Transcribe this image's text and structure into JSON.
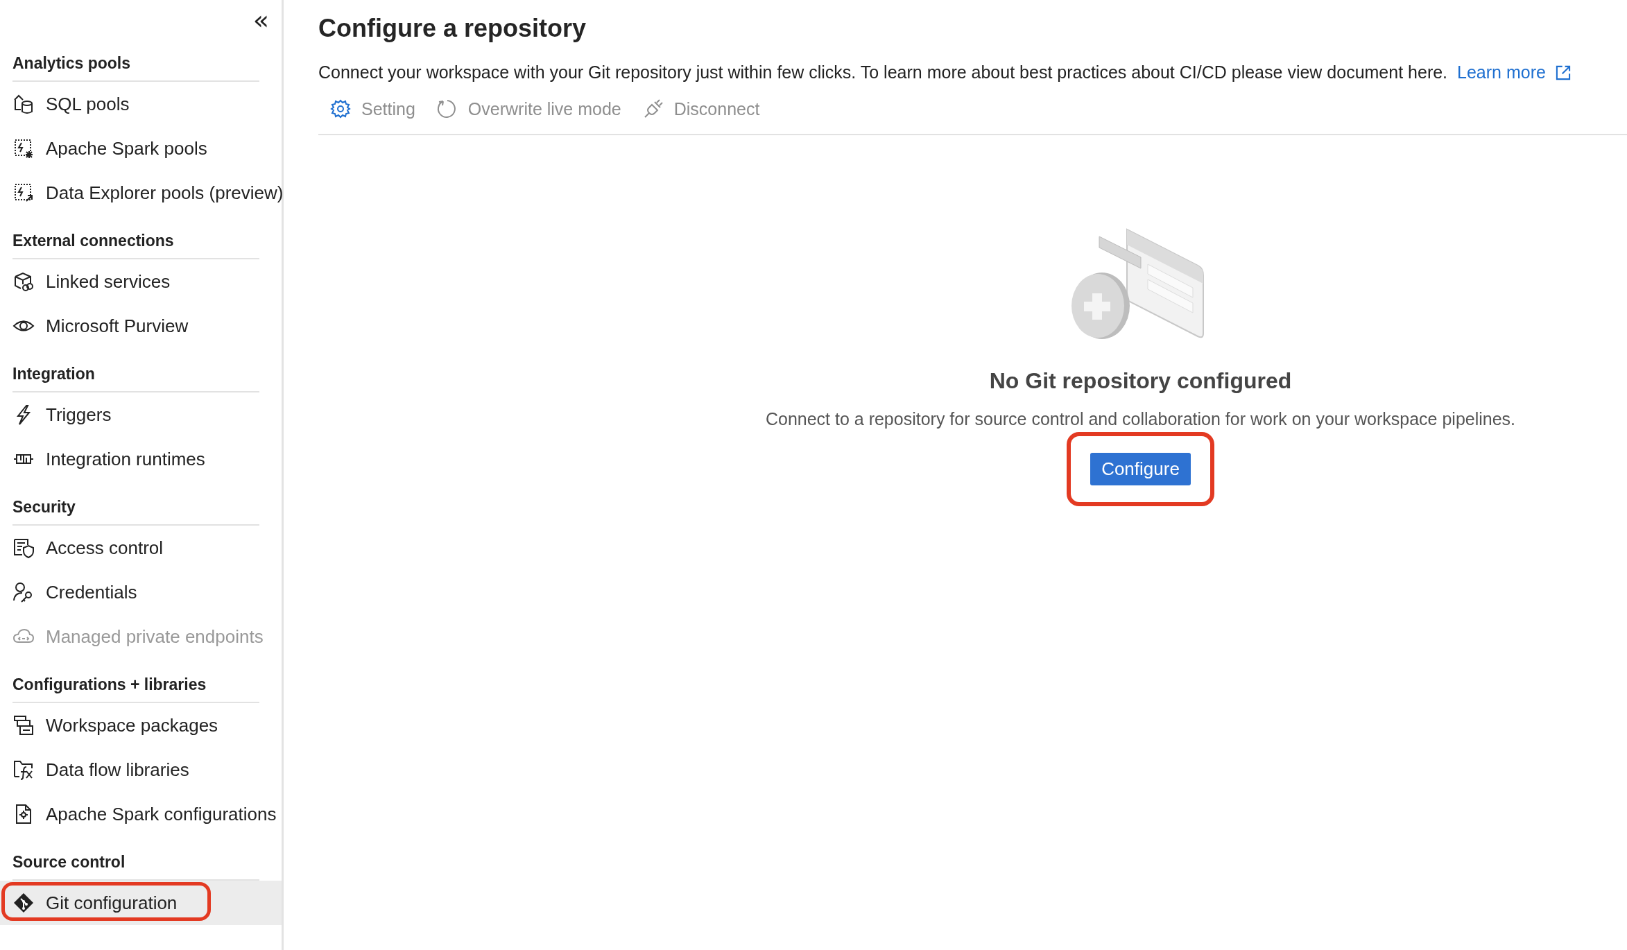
{
  "sidebar": {
    "collapse_label": "«",
    "sections": [
      {
        "heading": "Analytics pools",
        "items": [
          {
            "label": "SQL pools",
            "kind": "sql",
            "selected": false,
            "disabled": false,
            "highlighted": false
          },
          {
            "label": "Apache Spark pools",
            "kind": "spark",
            "selected": false,
            "disabled": false,
            "highlighted": false
          },
          {
            "label": "Data Explorer pools (preview)",
            "kind": "explorer",
            "selected": false,
            "disabled": false,
            "highlighted": false
          }
        ]
      },
      {
        "heading": "External connections",
        "items": [
          {
            "label": "Linked services",
            "kind": "linked",
            "selected": false,
            "disabled": false,
            "highlighted": false
          },
          {
            "label": "Microsoft Purview",
            "kind": "eye",
            "selected": false,
            "disabled": false,
            "highlighted": false
          }
        ]
      },
      {
        "heading": "Integration",
        "items": [
          {
            "label": "Triggers",
            "kind": "bolt",
            "selected": false,
            "disabled": false,
            "highlighted": false
          },
          {
            "label": "Integration runtimes",
            "kind": "runtime",
            "selected": false,
            "disabled": false,
            "highlighted": false
          }
        ]
      },
      {
        "heading": "Security",
        "items": [
          {
            "label": "Access control",
            "kind": "shield",
            "selected": false,
            "disabled": false,
            "highlighted": false
          },
          {
            "label": "Credentials",
            "kind": "key",
            "selected": false,
            "disabled": false,
            "highlighted": false
          },
          {
            "label": "Managed private endpoints",
            "kind": "cloud",
            "selected": false,
            "disabled": true,
            "highlighted": false
          }
        ]
      },
      {
        "heading": "Configurations + libraries",
        "items": [
          {
            "label": "Workspace packages",
            "kind": "packages",
            "selected": false,
            "disabled": false,
            "highlighted": false
          },
          {
            "label": "Data flow libraries",
            "kind": "fx",
            "selected": false,
            "disabled": false,
            "highlighted": false
          },
          {
            "label": "Apache Spark configurations",
            "kind": "config",
            "selected": false,
            "disabled": false,
            "highlighted": false
          }
        ]
      },
      {
        "heading": "Source control",
        "items": [
          {
            "label": "Git configuration",
            "kind": "git",
            "selected": true,
            "disabled": false,
            "highlighted": true
          }
        ]
      }
    ]
  },
  "main": {
    "title": "Configure a repository",
    "description": "Connect your workspace with your Git repository just within few clicks. To learn more about best practices about CI/CD please view document here.",
    "learn_more": "Learn more",
    "toolbar": [
      {
        "label": "Setting",
        "kind": "gear",
        "disabled": true
      },
      {
        "label": "Overwrite live mode",
        "kind": "refresh",
        "disabled": true
      },
      {
        "label": "Disconnect",
        "kind": "plug",
        "disabled": true
      }
    ],
    "empty_state": {
      "heading": "No Git repository configured",
      "message": "Connect to a repository for source control and collaboration for work on your workspace pipelines.",
      "button": {
        "label": "Configure",
        "highlighted": true
      }
    }
  }
}
